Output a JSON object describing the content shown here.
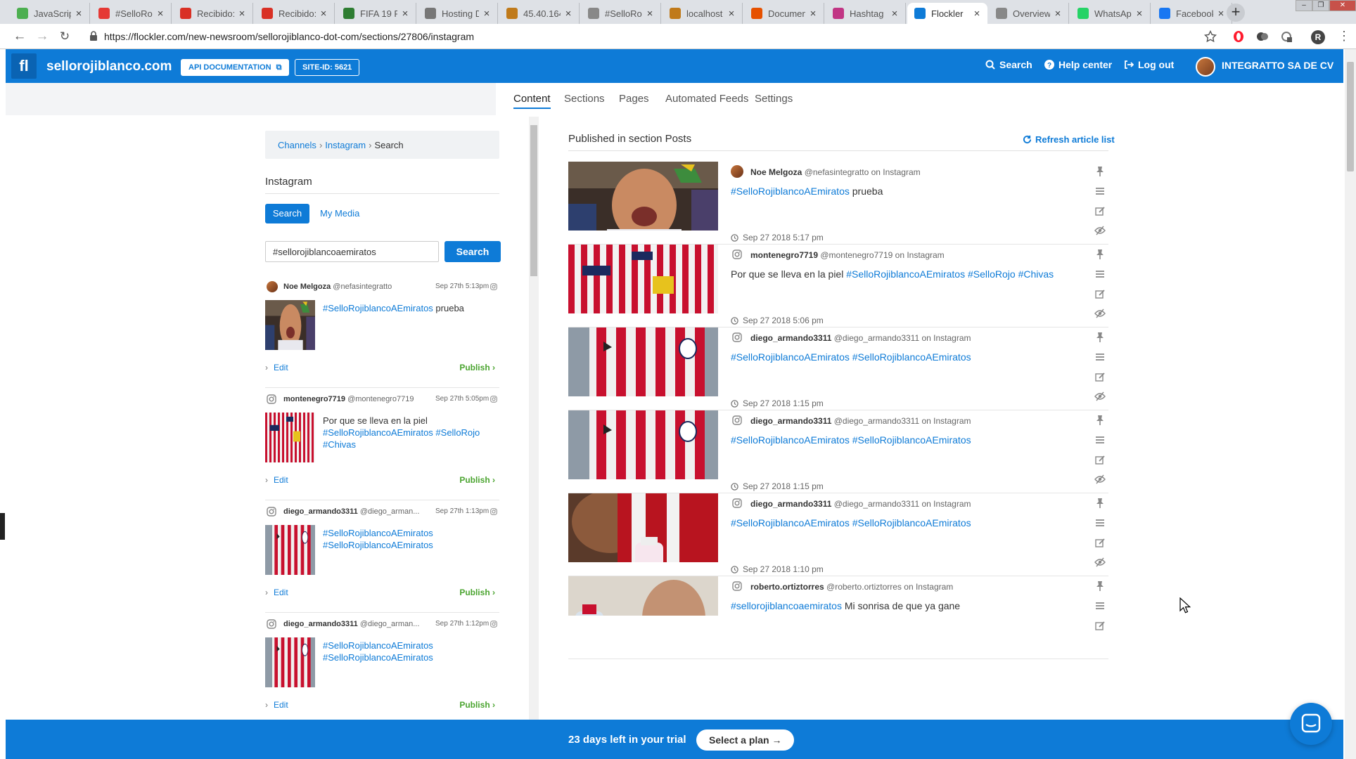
{
  "browser": {
    "tabs": [
      {
        "title": "JavaScrip",
        "icon": "bulb-icon",
        "color": "#4caf50"
      },
      {
        "title": "#SelloRo",
        "icon": "target-icon",
        "color": "#e53935"
      },
      {
        "title": "Recibido:",
        "icon": "gmail-icon",
        "color": "#d93025"
      },
      {
        "title": "Recibido:",
        "icon": "gmail-icon",
        "color": "#d93025"
      },
      {
        "title": "FIFA 19 P",
        "icon": "fifa-icon",
        "color": "#2e7d32"
      },
      {
        "title": "Hosting D",
        "icon": "hosting-icon",
        "color": "#777777"
      },
      {
        "title": "45.40.164",
        "icon": "server-icon",
        "color": "#c07a1a"
      },
      {
        "title": "#SelloRo",
        "icon": "document-icon",
        "color": "#888888"
      },
      {
        "title": "localhost",
        "icon": "server-icon",
        "color": "#c07a1a"
      },
      {
        "title": "Documen",
        "icon": "document-orange-icon",
        "color": "#e65100"
      },
      {
        "title": "Hashtag",
        "icon": "instagram-icon",
        "color": "#c13584"
      },
      {
        "title": "Flockler",
        "icon": "flockler-icon",
        "color": "#0e7bd7"
      },
      {
        "title": "Overview",
        "icon": "document-icon",
        "color": "#888888"
      },
      {
        "title": "WhatsAp",
        "icon": "whatsapp-icon",
        "color": "#25d366"
      },
      {
        "title": "Facebook",
        "icon": "facebook-icon",
        "color": "#1877f2"
      }
    ],
    "url": "https://flockler.com/new-newsroom/sellorojiblanco-dot-com/sections/27806/instagram",
    "profile_initial": "R"
  },
  "header": {
    "logo": "fl",
    "site_name": "sellorojiblanco.com",
    "api_doc": "API DOCUMENTATION",
    "site_id": "SITE-ID: 5621",
    "search": "Search",
    "help": "Help center",
    "logout": "Log out",
    "account": "INTEGRATTO SA DE CV",
    "brand_color": "#0e7bd7"
  },
  "subnav": {
    "tabs": [
      "Content",
      "Sections",
      "Pages",
      "Automated Feeds",
      "Settings"
    ],
    "active": "Content"
  },
  "source_panel": {
    "breadcrumb": [
      "Channels",
      "Instagram",
      "Search"
    ],
    "title": "Instagram",
    "tab_search": "Search",
    "tab_mymedia": "My Media",
    "search_value": "#sellorojiblancoaemiratos",
    "search_button": "Search",
    "edit_label": "Edit",
    "publish_label": "Publish",
    "results": [
      {
        "user": "Noe Melgoza",
        "handle": "@nefasintegratto",
        "date": "Sep 27th 5:13pm",
        "text_tags": "#SelloRojiblancoAEmiratos",
        "text_plain": " prueba",
        "avatar": true
      },
      {
        "user": "montenegro7719",
        "handle": "@montenegro7719",
        "date": "Sep 27th 5:05pm",
        "text_plain": "Por que se lleva en la piel",
        "text_tags": "#SelloRojiblancoAEmiratos #SelloRojo #Chivas",
        "avatar": false
      },
      {
        "user": "diego_armando3311",
        "handle": "@diego_arman...",
        "date": "Sep 27th 1:13pm",
        "text_tags": "#SelloRojiblancoAEmiratos #SelloRojiblancoAEmiratos",
        "avatar": false
      },
      {
        "user": "diego_armando3311",
        "handle": "@diego_arman...",
        "date": "Sep 27th 1:12pm",
        "text_tags": "#SelloRojiblancoAEmiratos #SelloRojiblancoAEmiratos",
        "avatar": false
      }
    ]
  },
  "published": {
    "title": "Published in section Posts",
    "refresh": "Refresh article list",
    "on_label": "on Instagram",
    "articles": [
      {
        "user": "Noe Melgoza",
        "handle": "@nefasintegratto",
        "tags": "#SelloRojiblancoAEmiratos",
        "after": " prueba",
        "before": "",
        "date": "Sep 27 2018 5:17 pm",
        "avatar": true
      },
      {
        "user": "montenegro7719",
        "handle": "@montenegro7719",
        "before": "Por que se lleva en la piel ",
        "tags": "#SelloRojiblancoAEmiratos #SelloRojo #Chivas",
        "after": "",
        "date": "Sep 27 2018 5:06 pm",
        "avatar": false
      },
      {
        "user": "diego_armando3311",
        "handle": "@diego_armando3311",
        "before": "",
        "tags": "#SelloRojiblancoAEmiratos #SelloRojiblancoAEmiratos",
        "after": "",
        "date": "Sep 27 2018 1:15 pm",
        "avatar": false
      },
      {
        "user": "diego_armando3311",
        "handle": "@diego_armando3311",
        "before": "",
        "tags": "#SelloRojiblancoAEmiratos #SelloRojiblancoAEmiratos",
        "after": "",
        "date": "Sep 27 2018 1:15 pm",
        "avatar": false
      },
      {
        "user": "diego_armando3311",
        "handle": "@diego_armando3311",
        "before": "",
        "tags": "#SelloRojiblancoAEmiratos #SelloRojiblancoAEmiratos",
        "after": "",
        "date": "Sep 27 2018 1:10 pm",
        "avatar": false
      },
      {
        "user": "roberto.ortiztorres",
        "handle": "@roberto.ortiztorres",
        "before": "",
        "tags": "#sellorojiblancoaemiratos",
        "after": " Mi sonrisa de que ya gane",
        "date": "",
        "avatar": false
      }
    ]
  },
  "footer": {
    "trial": "23 days left in your trial",
    "plan": "Select a plan →"
  }
}
